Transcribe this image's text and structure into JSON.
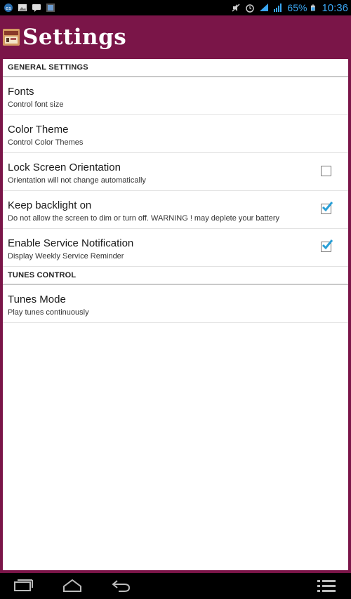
{
  "status_bar": {
    "battery_percent": "65%",
    "time": "10:36"
  },
  "action_bar": {
    "title": "Settings"
  },
  "sections": [
    {
      "header": "GENERAL SETTINGS",
      "items": [
        {
          "title": "Fonts",
          "summary": "Control font size"
        },
        {
          "title": "Color Theme",
          "summary": "Control Color Themes"
        },
        {
          "title": "Lock Screen Orientation",
          "summary": "Orientation will not change automatically",
          "checked": false
        },
        {
          "title": "Keep backlight on",
          "summary": "Do not allow the screen to dim or turn off. WARNING ! may deplete your battery",
          "checked": true
        },
        {
          "title": "Enable Service Notification",
          "summary": "Display Weekly Service Reminder",
          "checked": true
        }
      ]
    },
    {
      "header": "TUNES CONTROL",
      "items": [
        {
          "title": "Tunes Mode",
          "summary": "Play tunes continuously"
        }
      ]
    }
  ],
  "colors": {
    "action_bar": "#7a1548",
    "checkbox_tick": "#2a9fd6",
    "status_accent": "#3aa5f0"
  }
}
